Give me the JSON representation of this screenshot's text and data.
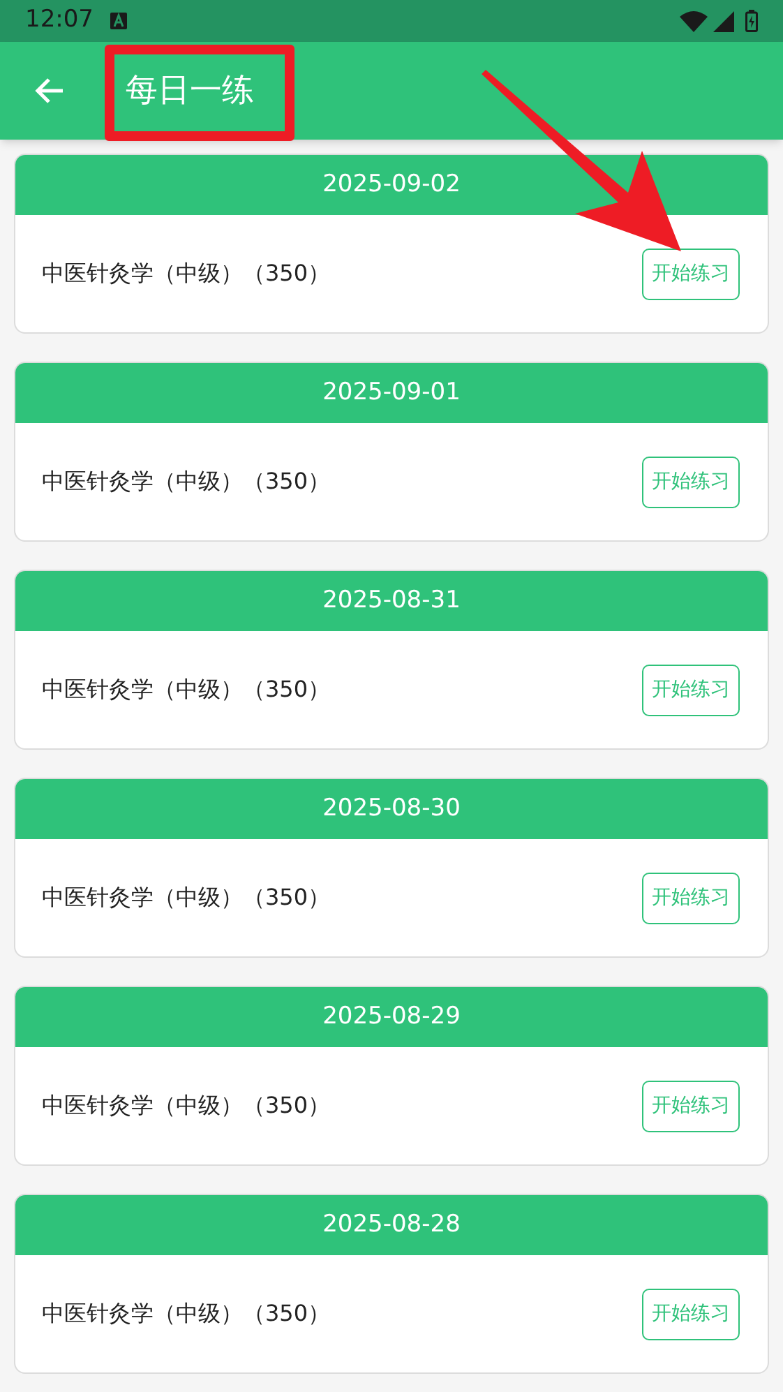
{
  "status_bar": {
    "time": "12:07"
  },
  "app_bar": {
    "title": "每日一练"
  },
  "cards": [
    {
      "date": "2025-09-02",
      "subject": "中医针灸学（中级）（350）",
      "button": "开始练习"
    },
    {
      "date": "2025-09-01",
      "subject": "中医针灸学（中级）（350）",
      "button": "开始练习"
    },
    {
      "date": "2025-08-31",
      "subject": "中医针灸学（中级）（350）",
      "button": "开始练习"
    },
    {
      "date": "2025-08-30",
      "subject": "中医针灸学（中级）（350）",
      "button": "开始练习"
    },
    {
      "date": "2025-08-29",
      "subject": "中医针灸学（中级）（350）",
      "button": "开始练习"
    },
    {
      "date": "2025-08-28",
      "subject": "中医针灸学（中级）（350）",
      "button": "开始练习"
    }
  ]
}
